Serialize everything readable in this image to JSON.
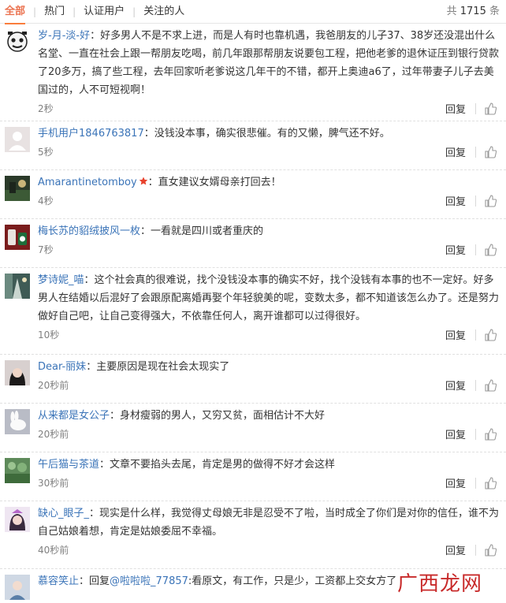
{
  "tabs": [
    "全部",
    "热门",
    "认证用户",
    "关注的人"
  ],
  "total": {
    "prefix": "共",
    "count": "1715",
    "suffix": "条"
  },
  "reply_label": "回复",
  "comments": [
    {
      "user": "岁-月-淡-好",
      "text": "：好多男人不是不求上进，而是人有时也靠机遇，我爸朋友的儿子37、38岁还没混出什么名堂、一直在社会上跟一帮朋友吃喝，前几年跟那帮朋友说要包工程，把他老爹的退休证压到银行贷款了20多万，搞了些工程，去年回家听老爹说这几年干的不错，都开上奥迪a6了，过年带妻子儿子去美国过的，人不可短视啊！",
      "time": "2秒"
    },
    {
      "user": "手机用户1846763817",
      "text": "：没钱没本事，确实很悲催。有的又懒，脾气还不好。",
      "time": "5秒"
    },
    {
      "user": "Amarantinetomboy",
      "text": "：直女建议女婿母亲打回去！",
      "time": "4秒"
    },
    {
      "user": "梅长苏的貂绒披风一枚",
      "text": "：一看就是四川或者重庆的",
      "time": "7秒"
    },
    {
      "user": "梦诗妮_喵",
      "text": "：这个社会真的很难说，找个没钱没本事的确实不好，找个没钱有本事的也不一定好。好多男人在结婚以后混好了会跟原配离婚再娶个年轻貌美的呢，变数太多，都不知道该怎么办了。还是努力做好自己吧，让自己变得强大，不依靠任何人，离开谁都可以过得很好。",
      "time": "10秒"
    },
    {
      "user": "Dear-丽妹",
      "text": "：主要原因是现在社会太现实了",
      "time": "20秒前"
    },
    {
      "user": "从来都是女公子",
      "text": "：身材瘦弱的男人，又穷又贫，面相估计不大好",
      "time": "20秒前"
    },
    {
      "user": "午后猫与茶道",
      "text": "：文章不要掐头去尾，肯定是男的做得不好才会这样",
      "time": "30秒前"
    },
    {
      "user": "缺心_眼子_",
      "text": "：现实是什么样，我觉得丈母娘无非是忍受不了啦，当时成全了你们是对你的信任，谁不为自己姑娘着想，肯定是姑娘委屈不幸福。",
      "time": "40秒前"
    },
    {
      "user": "慕容笑止",
      "text": "：回复",
      "reply_to": "@啦啦啦_77857",
      "text2": ":看原文，有工作，只是少，工资都上交女方了",
      "time": ""
    }
  ],
  "watermark": "广西龙网",
  "colors": {
    "accent": "#eb7350",
    "link": "#3b74b8",
    "meta": "#808080"
  },
  "icons": [
    "like-icon",
    "vip-star-icon"
  ]
}
